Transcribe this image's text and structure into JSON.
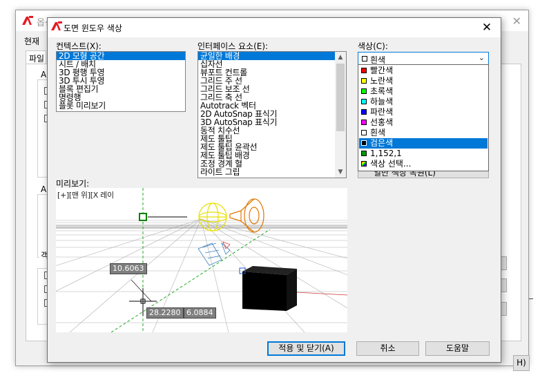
{
  "background_window": {
    "title": "옵션",
    "tab_label": "현재",
    "tab_file": "파일",
    "group_a_label": "A",
    "group_a2_label": "A",
    "group_obj_label": "객",
    "help_label": "H)"
  },
  "dialog": {
    "title": "도면 윈도우 색상",
    "close_icon": "close-icon"
  },
  "context": {
    "label": "컨텍스트(X):",
    "items": [
      "2D 모형 공간",
      "시트 / 배치",
      "3D 평행 투영",
      "3D 투시 투영",
      "블록 편집기",
      "명령행",
      "플롯 미리보기"
    ],
    "selected_index": 0
  },
  "interface": {
    "label": "인터페이스 요소(E):",
    "items": [
      "균일한 배경",
      "십자선",
      "뷰포트 컨트롤",
      "그리드 주 선",
      "그리드 보조 선",
      "그리드 축 선",
      "Autotrack 벡터",
      "2D AutoSnap 표식기",
      "3D AutoSnap 표식기",
      "동적 치수선",
      "제도 툴팁",
      "제도 툴팁 윤곽선",
      "제도 툴팁 배경",
      "조정 경계 혈",
      "라이트 그립"
    ],
    "selected_index": 0
  },
  "color": {
    "label": "색상(C):",
    "current": "흰색",
    "current_swatch": "#ffffff",
    "options": [
      {
        "name": "빨간색",
        "swatch": "#ff0000"
      },
      {
        "name": "노란색",
        "swatch": "#ffff00"
      },
      {
        "name": "초록색",
        "swatch": "#00ff00"
      },
      {
        "name": "하늘색",
        "swatch": "#00ffff"
      },
      {
        "name": "파란색",
        "swatch": "#0000ff"
      },
      {
        "name": "선홍색",
        "swatch": "#ff00ff"
      },
      {
        "name": "흰색",
        "swatch": "#ffffff"
      },
      {
        "name": "검은색",
        "swatch": "#000000"
      },
      {
        "name": "1,152,1",
        "swatch": "#019801"
      },
      {
        "name": "색상 선택...",
        "swatch": "multicolor"
      }
    ],
    "selected_index": 7,
    "hidden_button_label": "일반 색상 복원(L)"
  },
  "preview": {
    "label": "미리보기:",
    "viewport_label": "[+][맨 위][X 레이",
    "dim_1": "10.6063",
    "dim_2": "28.2280",
    "dim_3": "6.0884"
  },
  "buttons": {
    "apply_close": "적용 및 닫기(A)",
    "cancel": "취소",
    "help": "도움말"
  },
  "colors": {
    "accent": "#0078d7",
    "dialog_bg": "#f0f0f0",
    "cad_logo": "#e31b23"
  }
}
